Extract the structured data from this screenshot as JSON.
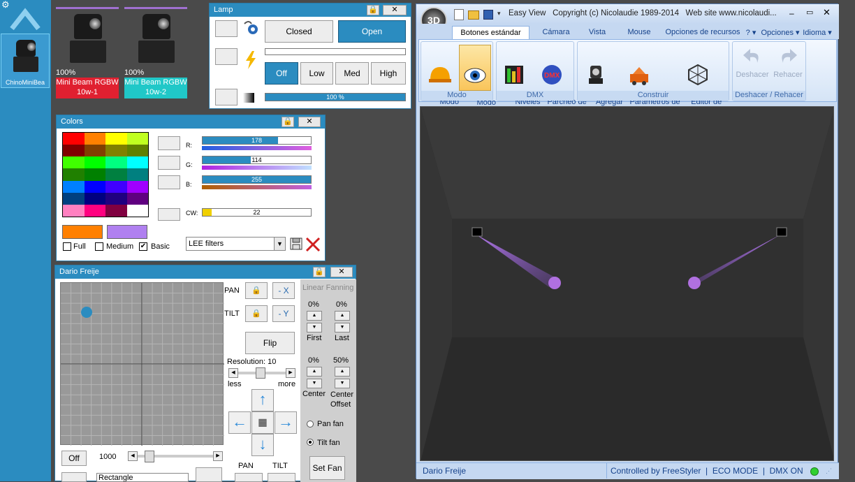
{
  "sidebar": {
    "fixture_label": "ChinoMiniBea"
  },
  "fixtures": [
    {
      "pct": "100%",
      "name": "Mini Beam RGBW 10w-1",
      "color": "#e02030"
    },
    {
      "pct": "100%",
      "name": "Mini Beam RGBW 10w-2",
      "color": "#20c8c8"
    }
  ],
  "lamp": {
    "title": "Lamp",
    "closed": "Closed",
    "open": "Open",
    "off": "Off",
    "low": "Low",
    "med": "Med",
    "high": "High",
    "dimmer": "100 %",
    "dimmer_value": 1.0
  },
  "colors": {
    "title": "Colors",
    "palette": [
      "#ff0000",
      "#ff8000",
      "#ffff00",
      "#c0ff20",
      "#800000",
      "#804000",
      "#808000",
      "#608000",
      "#40ff00",
      "#00ff00",
      "#00ff80",
      "#00ffff",
      "#208000",
      "#008000",
      "#008040",
      "#008080",
      "#0080ff",
      "#0000ff",
      "#4000ff",
      "#a000ff",
      "#004080",
      "#000080",
      "#200080",
      "#600080",
      "#ff80c0",
      "#ff0080",
      "#800040",
      "#ffffff"
    ],
    "swatch1": "#ff8000",
    "swatch2": "#b080f0",
    "r_label": "R:",
    "r_value": "178",
    "r_frac": 0.698,
    "g_label": "G:",
    "g_value": "114",
    "g_frac": 0.447,
    "b_label": "B:",
    "b_value": "255",
    "b_frac": 1.0,
    "cw_label": "CW:",
    "cw_value": "22",
    "cw_frac": 0.086,
    "full": "Full",
    "medium": "Medium",
    "basic": "Basic",
    "filters": "LEE filters"
  },
  "dario": {
    "title": "Dario Freije",
    "pan": "PAN",
    "tilt": "TILT",
    "minus_x": "- X",
    "minus_y": "- Y",
    "flip": "Flip",
    "resolution": "Resolution: 10",
    "less": "less",
    "more": "more",
    "linear_fanning": "Linear Fanning",
    "first_pct": "0%",
    "last_pct": "0%",
    "first": "First",
    "last": "Last",
    "center_pct": "0%",
    "offset_pct": "50%",
    "center": "Center",
    "center_offset": "Center\nOffset",
    "pan_fan": "Pan fan",
    "tilt_fan": "Tilt fan",
    "set_fan": "Set Fan",
    "off": "Off",
    "speed": "1000",
    "shape": "Rectangle",
    "pan2": "PAN",
    "tilt2": "TILT"
  },
  "main": {
    "title_text": "Easy View   Copyright (c) Nicolaudie 1989-2014   Web site www.nicolaudi...",
    "tabs": [
      "Botones estándar",
      "Cámara",
      "Vista",
      "Mouse",
      "Opciones de recursos",
      "? ▾",
      "Opciones ▾",
      "Idioma ▾"
    ],
    "groups": {
      "modo": "Modo",
      "dmx": "DMX",
      "construir": "Construir",
      "deshacer": "Deshacer / Rehacer"
    },
    "buttons": {
      "modo_construir": "Modo\nConstruir",
      "modo_usuario": "Modo\nusuario",
      "niveles": "Niveles\nDMX",
      "parcheo": "Parcheo de\nUniversos",
      "agregar": "Agregar\nLuz",
      "parametros": "Parámetros de\nescenario...",
      "editor": "Editor de\nObjetos simples",
      "deshacer": "Deshacer",
      "rehacer": "Rehacer"
    },
    "status_left": "Dario Freije",
    "status_right": "Controlled by FreeStyler  |  ECO MODE  |  DMX ON"
  }
}
